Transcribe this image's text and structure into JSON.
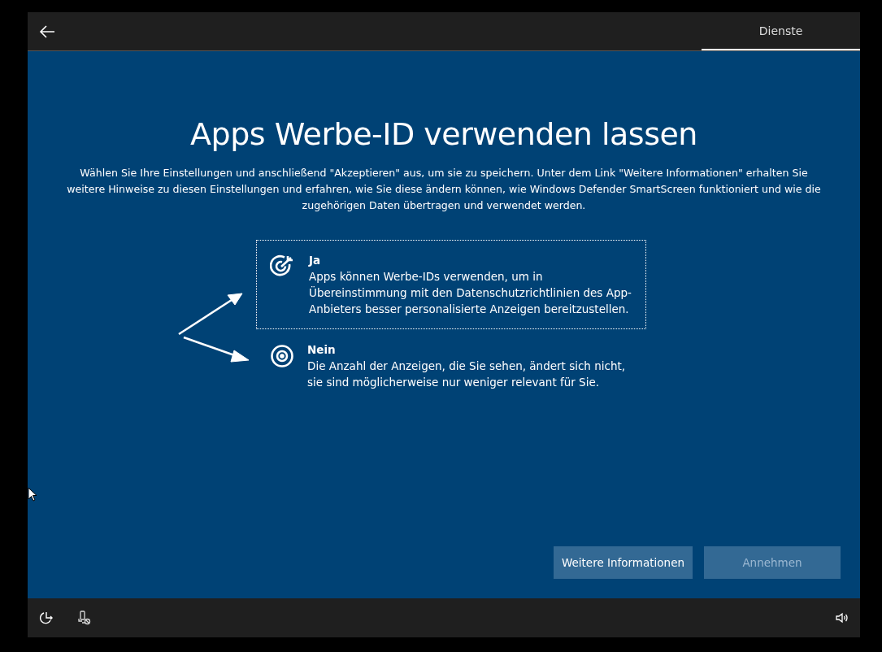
{
  "header": {
    "tabs": [
      {
        "label": "Dienste",
        "selected": true
      }
    ]
  },
  "title": "Apps Werbe-ID verwenden lassen",
  "description": "Wählen Sie Ihre Einstellungen und anschließend \"Akzeptieren\" aus, um sie zu speichern. Unter dem Link \"Weitere Informationen\" erhalten Sie weitere Hinweise zu diesen Einstellungen und erfahren, wie Sie diese ändern können, wie Windows Defender SmartScreen funktioniert und wie die zugehörigen Daten übertragen und verwendet werden.",
  "options": [
    {
      "kind": "yes",
      "label": "Ja",
      "text": "Apps können Werbe-IDs verwenden, um in Übereinstimmung mit den Datenschutzrichtlinien des App-Anbieters besser personalisierte Anzeigen bereitzustellen.",
      "focused": true
    },
    {
      "kind": "no",
      "label": "Nein",
      "text": "Die Anzahl der Anzeigen, die Sie sehen, ändert sich nicht, sie sind möglicherweise nur weniger relevant für Sie.",
      "focused": false
    }
  ],
  "buttons": [
    {
      "label": "Weitere Informationen",
      "disabled": false
    },
    {
      "label": "Annehmen",
      "disabled": true
    }
  ]
}
